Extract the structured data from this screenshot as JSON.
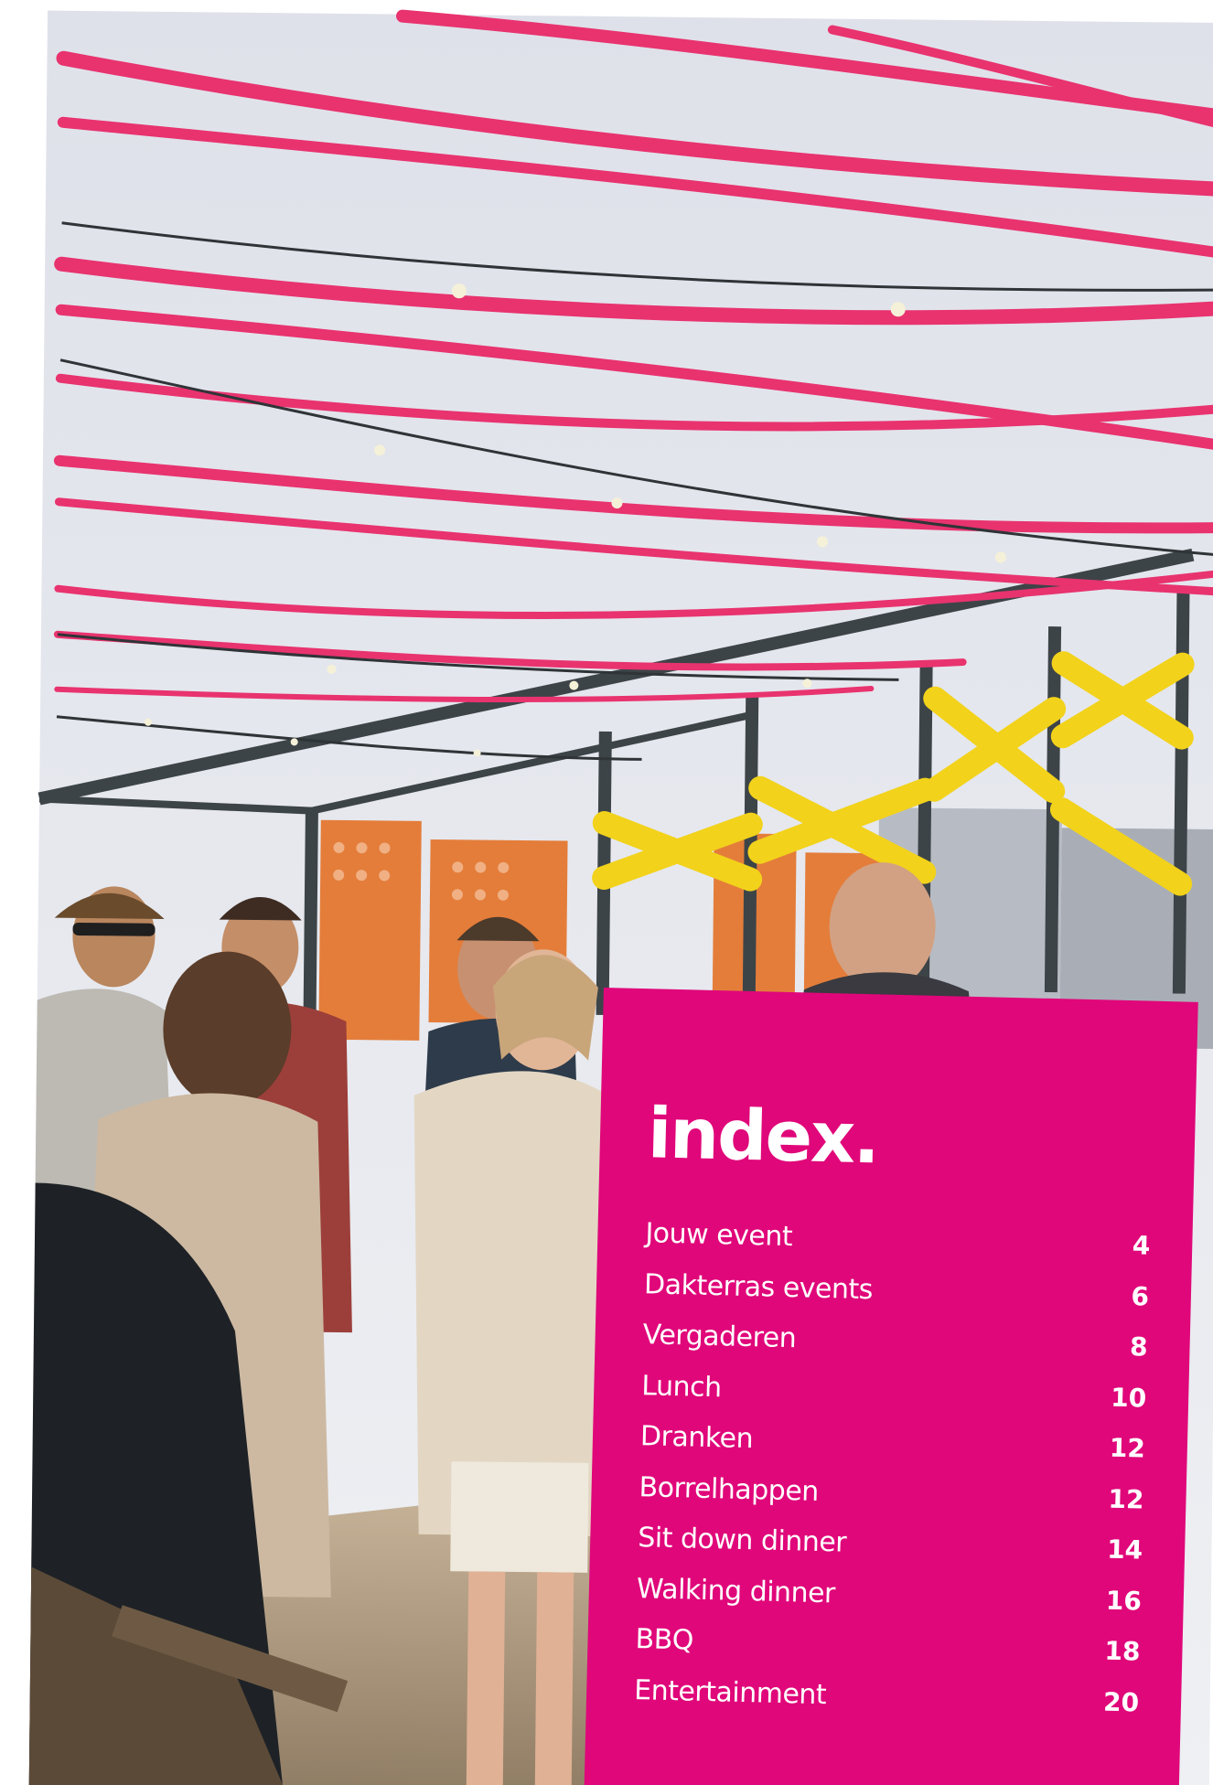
{
  "index": {
    "title": "index.",
    "items": [
      {
        "label": "Jouw event",
        "page": "4"
      },
      {
        "label": "Dakterras events",
        "page": "6"
      },
      {
        "label": "Vergaderen",
        "page": "8"
      },
      {
        "label": "Lunch",
        "page": "10"
      },
      {
        "label": "Dranken",
        "page": "12"
      },
      {
        "label": "Borrelhappen",
        "page": "12"
      },
      {
        "label": "Sit down dinner",
        "page": "14"
      },
      {
        "label": "Walking dinner",
        "page": "16"
      },
      {
        "label": "BBQ",
        "page": "18"
      },
      {
        "label": "Entertainment",
        "page": "20"
      }
    ]
  },
  "colors": {
    "brand_pink": "#e0077a",
    "ribbon_pink": "#e8336e",
    "ribbon_yellow": "#f2d21b",
    "sky": "#e6e7ee"
  }
}
